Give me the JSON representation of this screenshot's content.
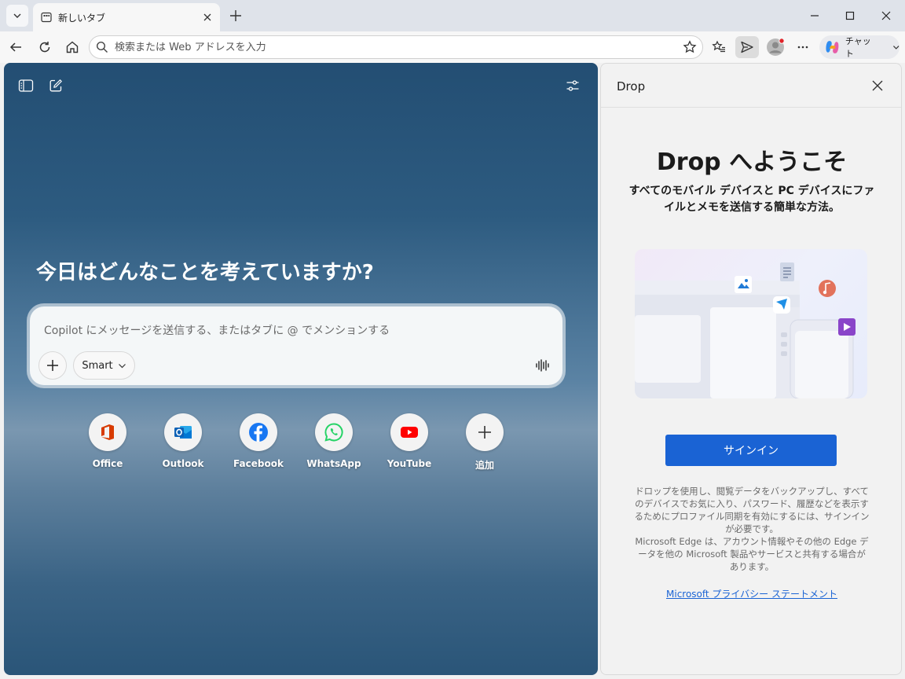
{
  "tab": {
    "title": "新しいタブ"
  },
  "address": {
    "placeholder": "検索または Web アドレスを入力",
    "value": ""
  },
  "toolbar": {
    "chat_label": "チャット"
  },
  "newtab": {
    "greeting": "今日はどんなことを考えていますか?",
    "composer_placeholder": "Copilot にメッセージを送信する、またはタブに @ でメンションする",
    "mode_label": "Smart",
    "shortcuts": [
      {
        "label": "Office",
        "icon": "office-icon"
      },
      {
        "label": "Outlook",
        "icon": "outlook-icon"
      },
      {
        "label": "Facebook",
        "icon": "facebook-icon"
      },
      {
        "label": "WhatsApp",
        "icon": "whatsapp-icon"
      },
      {
        "label": "YouTube",
        "icon": "youtube-icon"
      },
      {
        "label": "追加",
        "icon": "plus-icon"
      }
    ]
  },
  "drop": {
    "title": "Drop",
    "welcome": "Drop へようこそ",
    "subtitle": "すべてのモバイル デバイスと PC デバイスにファイルとメモを送信する簡単な方法。",
    "signin_label": "サインイン",
    "body1": "ドロップを使用し、閲覧データをバックアップし、すべてのデバイスでお気に入り、パスワード、履歴などを表示するためにプロファイル同期を有効にするには、サインインが必要です。",
    "body2": "Microsoft Edge は、アカウント情報やその他の Edge データを他の Microsoft 製品やサービスと共有する場合があります。",
    "privacy_link": "Microsoft プライバシー ステートメント"
  },
  "colors": {
    "accent": "#1a63d4",
    "notification_dot": "#e0242a"
  }
}
